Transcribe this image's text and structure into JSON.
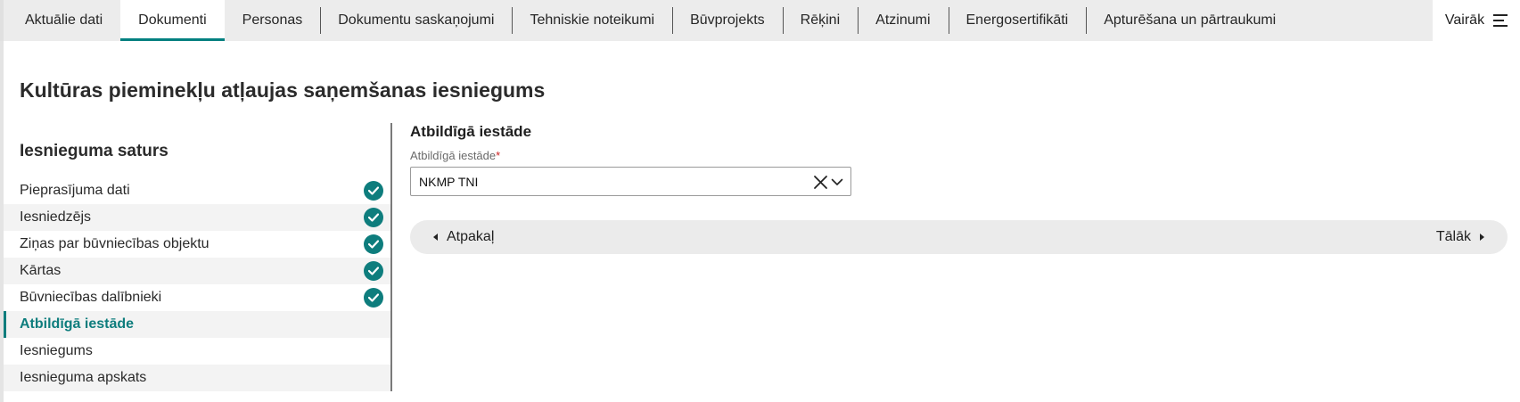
{
  "tabs": [
    {
      "label": "Aktuālie dati",
      "active": false
    },
    {
      "label": "Dokumenti",
      "active": true
    },
    {
      "label": "Personas",
      "active": false
    },
    {
      "label": "Dokumentu saskaņojumi",
      "active": false
    },
    {
      "label": "Tehniskie noteikumi",
      "active": false
    },
    {
      "label": "Būvprojekts",
      "active": false
    },
    {
      "label": "Rēķini",
      "active": false
    },
    {
      "label": "Atzinumi",
      "active": false
    },
    {
      "label": "Energosertifikāti",
      "active": false
    },
    {
      "label": "Apturēšana un pārtraukumi",
      "active": false
    }
  ],
  "more": {
    "label": "Vairāk",
    "icon": "hamburger-menu-icon"
  },
  "page": {
    "title": "Kultūras pieminekļu atļaujas saņemšanas iesniegums"
  },
  "sidebar": {
    "heading": "Iesnieguma saturs",
    "items": [
      {
        "label": "Pieprasījuma dati",
        "completed": true
      },
      {
        "label": "Iesniedzējs",
        "completed": true
      },
      {
        "label": "Ziņas par būvniecības objektu",
        "completed": true
      },
      {
        "label": "Kārtas",
        "completed": true
      },
      {
        "label": "Būvniecības dalībnieki",
        "completed": true
      },
      {
        "label": "Atbildīgā iestāde",
        "completed": false,
        "active": true
      },
      {
        "label": "Iesniegums",
        "completed": false
      },
      {
        "label": "Iesnieguma apskats",
        "completed": false
      }
    ]
  },
  "form": {
    "section_title": "Atbildīgā iestāde",
    "field_label": "Atbildīgā iestāde",
    "required_mark": "*",
    "value": "NKMP TNI"
  },
  "navigation": {
    "back_label": "Atpakaļ",
    "next_label": "Tālāk"
  },
  "colors": {
    "accent": "#0e7d7d",
    "required": "#cc2222"
  }
}
